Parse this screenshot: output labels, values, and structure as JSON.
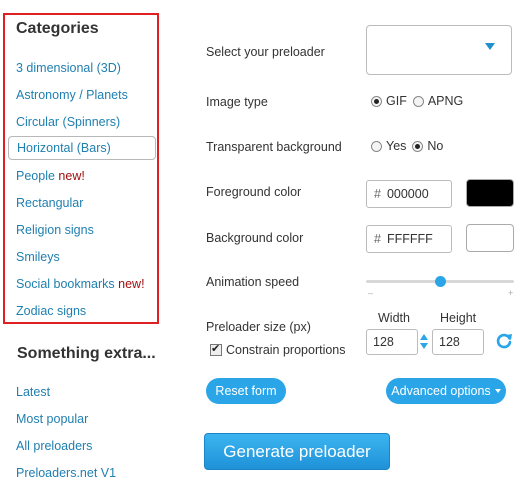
{
  "sidebar": {
    "categories_title": "Categories",
    "categories": [
      {
        "label": "3 dimensional (3D)",
        "badge": ""
      },
      {
        "label": "Astronomy / Planets",
        "badge": ""
      },
      {
        "label": "Circular (Spinners)",
        "badge": ""
      },
      {
        "label": "Horizontal (Bars)",
        "badge": ""
      },
      {
        "label": "People",
        "badge": "new!"
      },
      {
        "label": "Rectangular",
        "badge": ""
      },
      {
        "label": "Religion signs",
        "badge": ""
      },
      {
        "label": "Smileys",
        "badge": ""
      },
      {
        "label": "Social bookmarks",
        "badge": "new!"
      },
      {
        "label": "Zodiac signs",
        "badge": ""
      }
    ],
    "selected_category": "Horizontal (Bars)",
    "extra_title": "Something extra...",
    "extra_links": [
      "Latest",
      "Most popular",
      "All preloaders",
      "Preloaders.net V1"
    ]
  },
  "form": {
    "preloader_label": "Select your preloader",
    "preloader_value": "",
    "image_type_label": "Image type",
    "image_type_options": [
      "GIF",
      "APNG"
    ],
    "image_type_selected": "GIF",
    "transparent_label": "Transparent background",
    "transparent_options": [
      "Yes",
      "No"
    ],
    "transparent_selected": "No",
    "foreground_label": "Foreground color",
    "foreground_hash": "#",
    "foreground_value": "000000",
    "foreground_swatch": "#000000",
    "background_label": "Background color",
    "background_hash": "#",
    "background_value": "FFFFFF",
    "background_swatch": "#FFFFFF",
    "speed_label": "Animation speed",
    "speed_minus": "–",
    "speed_plus": "+",
    "speed_level": 0.5,
    "size_label": "Preloader size (px)",
    "width_label": "Width",
    "height_label": "Height",
    "width_value": "128",
    "height_value": "128",
    "constrain_label": "Constrain proportions",
    "constrain_checked": true,
    "reset_label": "Reset form",
    "advanced_label": "Advanced options",
    "generate_label": "Generate preloader"
  },
  "colors": {
    "accent": "#2aa5e8",
    "link": "#1f7fb0",
    "highlight_border": "#e02020",
    "new_badge": "#a01010"
  },
  "icons": {
    "dropdown": "chevron-down-icon",
    "refresh": "refresh-icon",
    "link_toggle": "link-arrows-icon",
    "advanced_caret": "caret-down-icon"
  }
}
